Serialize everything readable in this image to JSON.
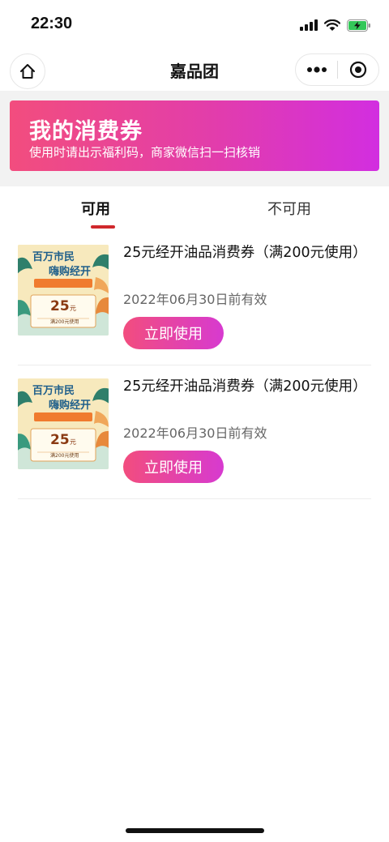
{
  "status_bar": {
    "time": "22:30"
  },
  "nav": {
    "title": "嘉品团"
  },
  "banner": {
    "title": "我的消费券",
    "subtitle": "使用时请出示福利码，商家微信扫一扫核销"
  },
  "tabs": [
    {
      "label": "可用",
      "active": true
    },
    {
      "label": "不可用",
      "active": false
    }
  ],
  "coupons": [
    {
      "name": "25元经开油品消费券（满200元使用）",
      "expiry": "2022年06月30日前有效",
      "button": "立即使用",
      "image": {
        "line1": "百万市民",
        "line2": "嗨购经开",
        "value": "25",
        "unit": "元",
        "condition": "满200元使用"
      }
    },
    {
      "name": "25元经开油品消费券（满200元使用）",
      "expiry": "2022年06月30日前有效",
      "button": "立即使用",
      "image": {
        "line1": "百万市民",
        "line2": "嗨购经开",
        "value": "25",
        "unit": "元",
        "condition": "满200元使用"
      }
    }
  ],
  "colors": {
    "accent": "#f24d7e",
    "accent_end": "#d22ee0",
    "tab_indicator": "#d0282c"
  }
}
